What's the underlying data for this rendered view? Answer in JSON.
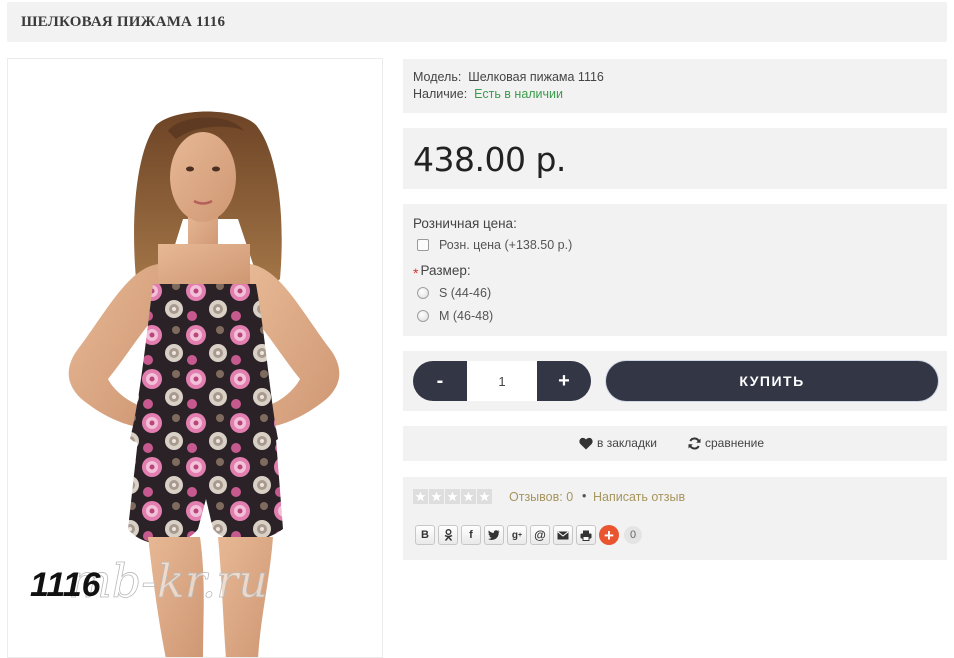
{
  "product": {
    "title": "ШЕЛКОВАЯ ПИЖАМА 1116",
    "image": {
      "alt_label": "1116",
      "watermark": "mb-kr.ru"
    },
    "info": {
      "model_label": "Модель:",
      "model_value": "Шелковая пижама 1116",
      "stock_label": "Наличие:",
      "stock_value": "Есть в наличии",
      "stock_color": "#3c9a4c"
    },
    "price": "438.00 р.",
    "options": {
      "retail_label": "Розничная цена:",
      "retail_checkbox_label": "Розн. цена (+138.50 р.)",
      "size_required_mark": "*",
      "size_label": "Размер:",
      "size_options": [
        "S (44-46)",
        "M (46-48)"
      ]
    },
    "buy": {
      "minus": "-",
      "quantity": "1",
      "plus": "+",
      "buy_label": "КУПИТЬ",
      "button_color": "#333645"
    },
    "links": {
      "wishlist": "в закладки",
      "compare": "сравнение"
    },
    "reviews": {
      "rating": 0,
      "max_rating": 5,
      "count_text": "Отзывов: 0",
      "separator": "•",
      "write_text": "Написать отзыв",
      "link_color": "#a7955e"
    },
    "share": {
      "buttons": [
        "vk-icon",
        "odnoklassniki-icon",
        "facebook-icon",
        "twitter-icon",
        "google-plus-icon",
        "mail-ru-icon",
        "email-icon",
        "print-icon"
      ],
      "count": "0"
    }
  }
}
